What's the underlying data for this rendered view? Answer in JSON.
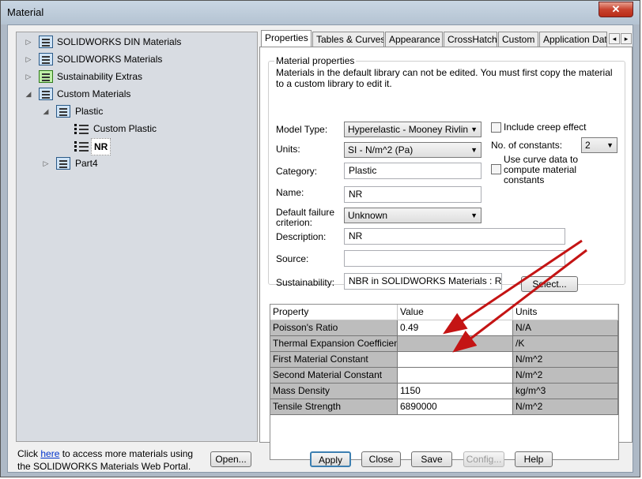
{
  "window": {
    "title": "Material",
    "close_glyph": "✕"
  },
  "tree": {
    "items": [
      {
        "label": "SOLIDWORKS DIN Materials",
        "arrow": "▷",
        "icon": "library-book-icon"
      },
      {
        "label": "SOLIDWORKS Materials",
        "arrow": "▷",
        "icon": "library-book-icon"
      },
      {
        "label": "Sustainability Extras",
        "arrow": "▷",
        "icon": "sustainability-library-icon"
      },
      {
        "label": "Custom Materials",
        "arrow": "◢",
        "icon": "library-book-icon"
      },
      {
        "label": "Plastic",
        "arrow": "◢",
        "icon": "category-folder-icon"
      },
      {
        "label": "Custom Plastic",
        "icon": "material-list-icon"
      },
      {
        "label": "NR",
        "icon": "material-list-icon"
      },
      {
        "label": "Part4",
        "arrow": "▷",
        "icon": "category-folder-icon"
      }
    ]
  },
  "footer": {
    "text_before": "Click ",
    "link": "here",
    "text_after": " to access more materials using the SOLIDWORKS Materials Web Portal.",
    "open_label": "Open..."
  },
  "tabs": [
    "Properties",
    "Tables & Curves",
    "Appearance",
    "CrossHatch",
    "Custom",
    "Application Data"
  ],
  "tab_scroll": {
    "left": "◂",
    "right": "▸"
  },
  "properties": {
    "group_title": "Material properties",
    "note": "Materials in the default library can not be edited. You must first copy the material to a custom library to edit it.",
    "model_type_label": "Model Type:",
    "model_type_value": "Hyperelastic - Mooney Rivlin",
    "units_label": "Units:",
    "units_value": "SI - N/m^2 (Pa)",
    "category_label": "Category:",
    "category_value": "Plastic",
    "name_label": "Name:",
    "name_value": "NR",
    "failure_label_1": "Default failure",
    "failure_label_2": "criterion:",
    "failure_value": "Unknown",
    "description_label": "Description:",
    "description_value": "NR",
    "source_label": "Source:",
    "source_value": "",
    "sustainability_label": "Sustainability:",
    "sustainability_value": "NBR in SOLIDWORKS Materials : Rubber",
    "select_label": "Select...",
    "creep_label": "Include creep effect",
    "constants_label": "No. of constants:",
    "constants_value": "2",
    "curve_label_1": "Use curve data to",
    "curve_label_2": "compute material",
    "curve_label_3": "constants",
    "dropdown_glyph": "▼"
  },
  "table": {
    "headers": [
      "Property",
      "Value",
      "Units"
    ],
    "rows": [
      {
        "property": "Poisson's Ratio",
        "value": "0.49",
        "units": "N/A"
      },
      {
        "property": "Thermal Expansion Coefficient",
        "value": "",
        "units": "/K"
      },
      {
        "property": "First Material Constant",
        "value": "",
        "units": "N/m^2"
      },
      {
        "property": "Second Material Constant",
        "value": "",
        "units": "N/m^2"
      },
      {
        "property": "Mass Density",
        "value": "1150",
        "units": "kg/m^3"
      },
      {
        "property": "Tensile Strength",
        "value": "6890000",
        "units": "N/m^2"
      }
    ]
  },
  "buttons": {
    "apply": "Apply",
    "close": "Close",
    "save": "Save",
    "config": "Config...",
    "help": "Help"
  },
  "colors": {
    "arrow_red": "#c41414",
    "window_frame": "#aeb9c6",
    "table_gray": "#bdbdbd",
    "link_blue": "#0033cc"
  }
}
